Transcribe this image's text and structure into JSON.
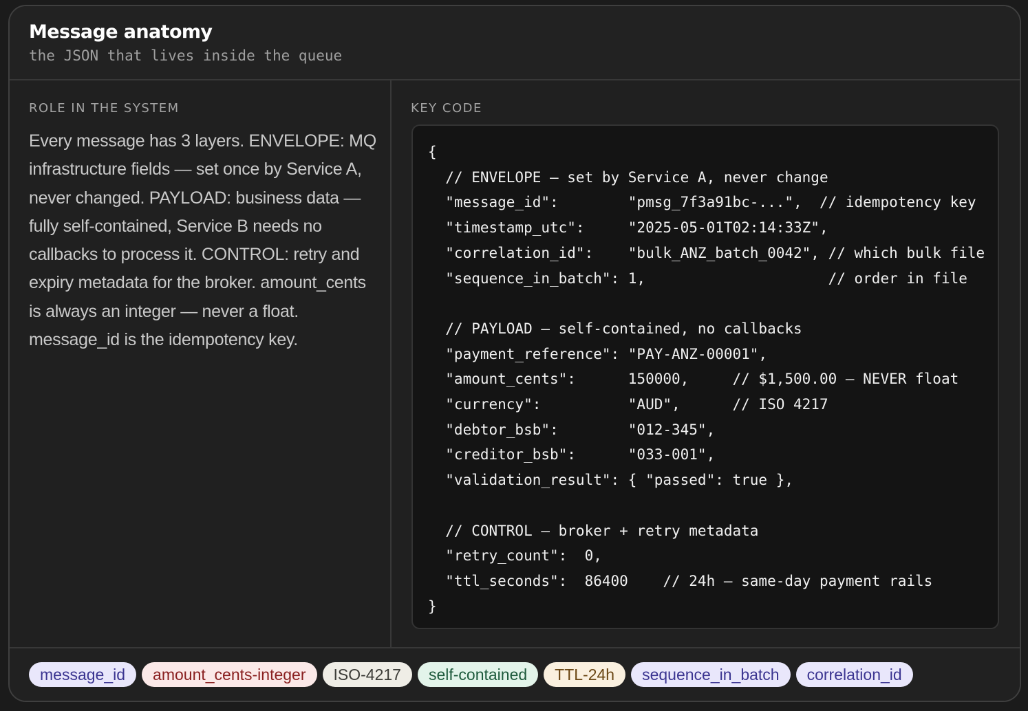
{
  "header": {
    "title": "Message anatomy",
    "subtitle": "the JSON that lives inside the queue"
  },
  "role": {
    "label": "ROLE IN THE SYSTEM",
    "text": "Every message has 3 layers. ENVELOPE: MQ infrastructure fields — set once by Service A, never changed. PAYLOAD: business data — fully self-contained, Service B needs no callbacks to process it. CONTROL: retry and expiry metadata for the broker. amount_cents is always an integer — never a float. message_id is the idempotency key."
  },
  "key_code": {
    "label": "KEY CODE",
    "code": "{\n  // ENVELOPE — set by Service A, never change\n  \"message_id\":        \"pmsg_7f3a91bc-...\",  // idempotency key\n  \"timestamp_utc\":     \"2025-05-01T02:14:33Z\",\n  \"correlation_id\":    \"bulk_ANZ_batch_0042\", // which bulk file\n  \"sequence_in_batch\": 1,                     // order in file\n\n  // PAYLOAD — self-contained, no callbacks\n  \"payment_reference\": \"PAY-ANZ-00001\",\n  \"amount_cents\":      150000,     // $1,500.00 — NEVER float\n  \"currency\":          \"AUD\",      // ISO 4217\n  \"debtor_bsb\":        \"012-345\",\n  \"creditor_bsb\":      \"033-001\",\n  \"validation_result\": { \"passed\": true },\n\n  // CONTROL — broker + retry metadata\n  \"retry_count\":  0,\n  \"ttl_seconds\":  86400    // 24h — same-day payment rails\n}"
  },
  "tags": [
    {
      "label": "message_id",
      "bg": "#e9e7fb",
      "color": "#3b3591"
    },
    {
      "label": "amount_cents-integer",
      "bg": "#fbe9e8",
      "color": "#8a2020"
    },
    {
      "label": "ISO-4217",
      "bg": "#efede6",
      "color": "#3c3c38"
    },
    {
      "label": "self-contained",
      "bg": "#e3f4ea",
      "color": "#1f5b3d"
    },
    {
      "label": "TTL-24h",
      "bg": "#faf0df",
      "color": "#6b4714"
    },
    {
      "label": "sequence_in_batch",
      "bg": "#e9e7fb",
      "color": "#3b3591"
    },
    {
      "label": "correlation_id",
      "bg": "#e9e7fb",
      "color": "#3b3591"
    }
  ]
}
